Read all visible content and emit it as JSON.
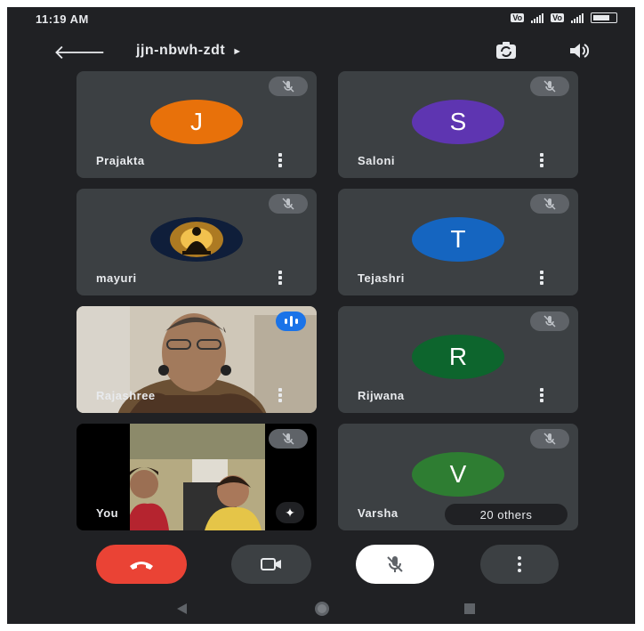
{
  "status_bar": {
    "time": "11:19 AM",
    "vol_badge_1": "Vo",
    "vol_badge_2": "Vo"
  },
  "header": {
    "meeting_code": "jjn-nbwh-zdt",
    "caret": "►"
  },
  "participants": [
    {
      "name": "Prajakta",
      "initial": "J",
      "color": "#e8710a",
      "muted": true
    },
    {
      "name": "Saloni",
      "initial": "S",
      "color": "#5e35b1",
      "muted": true
    },
    {
      "name": "mayuri",
      "initial": "",
      "avatar": "buddha-image",
      "muted": true
    },
    {
      "name": "Tejashri",
      "initial": "T",
      "color": "#1565c0",
      "muted": true
    },
    {
      "name": "Rajashree",
      "video": true,
      "speaking": true
    },
    {
      "name": "Rijwana",
      "initial": "R",
      "color": "#0d652d",
      "muted": true
    },
    {
      "name": "You",
      "video": true,
      "muted": true
    },
    {
      "name": "Varsha",
      "initial": "V",
      "color": "#2e7d32",
      "muted": true
    }
  ],
  "others_chip": "20 others",
  "controls": {
    "end_call_color": "#ea4335"
  }
}
